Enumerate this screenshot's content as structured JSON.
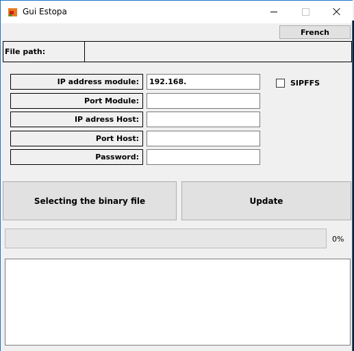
{
  "window": {
    "title": "Gui Estopa",
    "icon": "app-icon",
    "controls": [
      "minimize",
      "maximize",
      "close"
    ]
  },
  "toolbar": {
    "language_button_label": "French"
  },
  "file_path": {
    "label": "File path:",
    "value": ""
  },
  "form": {
    "fields": [
      {
        "label": "IP address module:",
        "value": "192.168."
      },
      {
        "label": "Port Module:",
        "value": ""
      },
      {
        "label": "IP adress Host:",
        "value": ""
      },
      {
        "label": "Port Host:",
        "value": ""
      },
      {
        "label": "Password:",
        "value": ""
      }
    ],
    "checkbox": {
      "label": "SIPFFS",
      "checked": false
    }
  },
  "actions": {
    "select_file_label": "Selecting the binary file",
    "update_label": "Update"
  },
  "progress": {
    "percent": 0,
    "text": "0%"
  },
  "log": {
    "value": ""
  },
  "colors": {
    "window_border": "#1a73c8",
    "background": "#f0f0f0",
    "button_face": "#e1e1e1",
    "progress_fill": "#06b025"
  }
}
